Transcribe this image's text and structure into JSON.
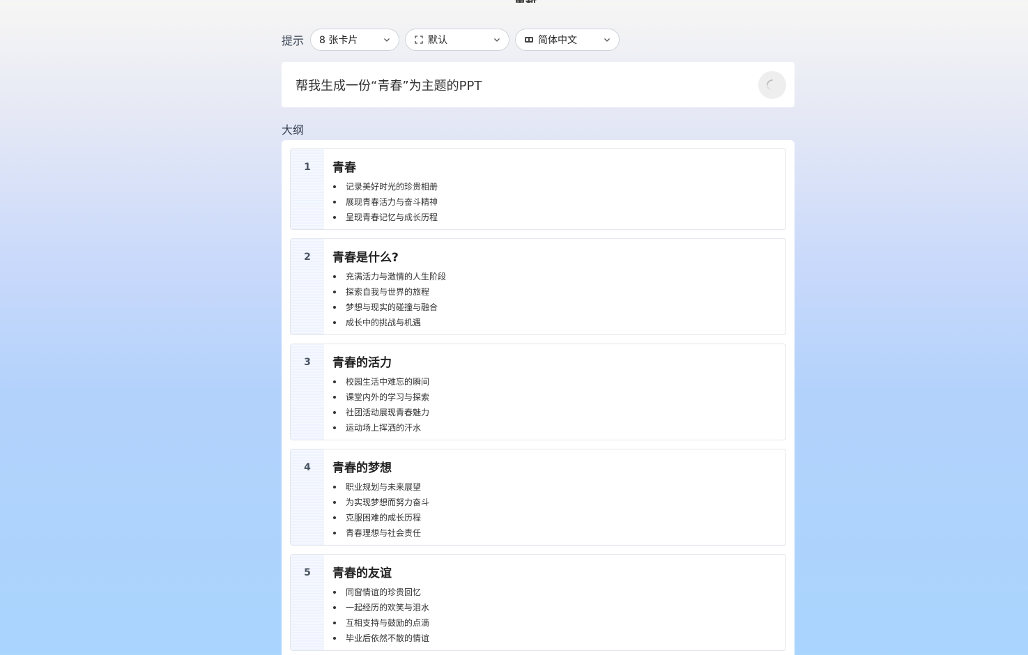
{
  "page": {
    "top_title": "重新",
    "prompt_label": "提示",
    "outline_label": "大纲"
  },
  "controls": {
    "cards": {
      "value": "8 张卡片",
      "icon": "chevron-down-icon"
    },
    "theme": {
      "value": "默认",
      "icon": "frame-icon"
    },
    "language": {
      "value": "简体中文",
      "icon": "language-icon"
    }
  },
  "prompt": {
    "text": "帮我生成一份“青春”为主题的PPT",
    "status_icon": "loading-spinner-icon"
  },
  "outline": [
    {
      "num": "1",
      "title": "青春",
      "points": [
        "记录美好时光的珍贵相册",
        "展现青春活力与奋斗精神",
        "呈现青春记忆与成长历程"
      ]
    },
    {
      "num": "2",
      "title": "青春是什么?",
      "points": [
        "充满活力与激情的人生阶段",
        "探索自我与世界的旅程",
        "梦想与现实的碰撞与融合",
        "成长中的挑战与机遇"
      ]
    },
    {
      "num": "3",
      "title": "青春的活力",
      "points": [
        "校园生活中难忘的瞬间",
        "课堂内外的学习与探索",
        "社团活动展现青春魅力",
        "运动场上挥洒的汗水"
      ]
    },
    {
      "num": "4",
      "title": "青春的梦想",
      "points": [
        "职业规划与未来展望",
        "为实现梦想而努力奋斗",
        "克服困难的成长历程",
        "青春理想与社会责任"
      ]
    },
    {
      "num": "5",
      "title": "青春的友谊",
      "points": [
        "同窗情谊的珍贵回忆",
        "一起经历的欢笑与泪水",
        "互相支持与鼓励的点滴",
        "毕业后依然不散的情谊"
      ]
    }
  ]
}
